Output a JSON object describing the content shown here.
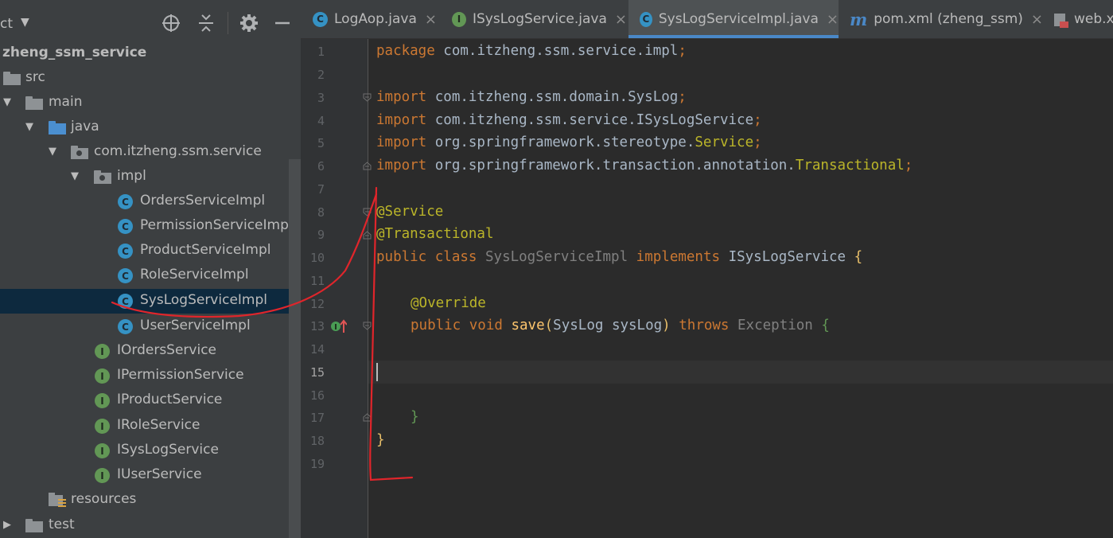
{
  "sidebar": {
    "title": "ct",
    "tools": [
      "locate-icon",
      "collapse-icon",
      "gear-icon",
      "hide-icon"
    ],
    "tree": [
      {
        "label": "zheng_ssm_service",
        "type": "module",
        "bold": true
      },
      {
        "label": "src",
        "type": "folder"
      },
      {
        "label": "main",
        "type": "folder",
        "expanded": true
      },
      {
        "label": "java",
        "type": "source-folder",
        "expanded": true
      },
      {
        "label": "com.itzheng.ssm.service",
        "type": "package",
        "expanded": true
      },
      {
        "label": "impl",
        "type": "package",
        "expanded": true
      },
      {
        "label": "OrdersServiceImpl",
        "type": "class"
      },
      {
        "label": "PermissionServiceImp",
        "type": "class"
      },
      {
        "label": "ProductServiceImpl",
        "type": "class"
      },
      {
        "label": "RoleServiceImpl",
        "type": "class"
      },
      {
        "label": "SysLogServiceImpl",
        "type": "class",
        "selected": true
      },
      {
        "label": "UserServiceImpl",
        "type": "class"
      },
      {
        "label": "IOrdersService",
        "type": "interface"
      },
      {
        "label": "IPermissionService",
        "type": "interface"
      },
      {
        "label": "IProductService",
        "type": "interface"
      },
      {
        "label": "IRoleService",
        "type": "interface"
      },
      {
        "label": "ISysLogService",
        "type": "interface"
      },
      {
        "label": "IUserService",
        "type": "interface"
      },
      {
        "label": "resources",
        "type": "resources"
      },
      {
        "label": "test",
        "type": "folder",
        "expanded": false
      }
    ]
  },
  "tabs": [
    {
      "label": "LogAop.java",
      "icon": "class-icon",
      "close": "×"
    },
    {
      "label": "ISysLogService.java",
      "icon": "interface-icon",
      "close": "×"
    },
    {
      "label": "SysLogServiceImpl.java",
      "icon": "class-icon",
      "active": true,
      "close": "×"
    },
    {
      "label": "pom.xml (zheng_ssm)",
      "icon": "maven-icon",
      "close": "×"
    },
    {
      "label": "web.x",
      "icon": "xml-icon"
    }
  ],
  "tab_icon_letters": {
    "class": "C",
    "interface": "I",
    "maven": "m"
  },
  "editor": {
    "line_numbers": [
      "1",
      "2",
      "3",
      "4",
      "5",
      "6",
      "7",
      "8",
      "9",
      "10",
      "11",
      "12",
      "13",
      "14",
      "15",
      "16",
      "17",
      "18",
      "19"
    ],
    "current_line": "15",
    "code": {
      "l1": {
        "kw": "package",
        "rest": " com.itzheng.ssm.service.impl",
        "semi": ";"
      },
      "l3": {
        "kw": "import",
        "rest": " com.itzheng.ssm.domain.SysLog",
        "semi": ";"
      },
      "l4": {
        "kw": "import",
        "rest": " com.itzheng.ssm.service.ISysLogService",
        "semi": ";"
      },
      "l5": {
        "kw": "import",
        "rest": " org.springframework.stereotype.",
        "cls": "Service",
        "semi": ";"
      },
      "l6": {
        "kw": "import",
        "rest": " org.springframework.transaction.annotation.",
        "cls": "Transactional",
        "semi": ";"
      },
      "l8": {
        "ann": "@Service"
      },
      "l9": {
        "ann": "@Transactional"
      },
      "l10": {
        "kw1": "public",
        "kw2": "class",
        "name": "SysLogServiceImpl",
        "kw3": "implements",
        "iface": "ISysLogService",
        "brace": "{"
      },
      "l12": {
        "ann": "@Override"
      },
      "l13": {
        "kw1": "public",
        "kw2": "void",
        "fn": "save",
        "open": "(",
        "type": "SysLog",
        "param": "sysLog",
        "close": ")",
        "kw3": "throws",
        "exc": "Exception",
        "brace": "{"
      },
      "l17": {
        "brace": "}"
      },
      "l18": {
        "brace": "}"
      }
    }
  },
  "colors": {
    "keyword": "#cc7832",
    "annotation": "#bbb529",
    "function": "#ffc66d",
    "text": "#a9b7c6",
    "unused": "#808080",
    "accent": "#4a88c7",
    "selection": "#0d293e",
    "red_marker": "#e0252b"
  }
}
